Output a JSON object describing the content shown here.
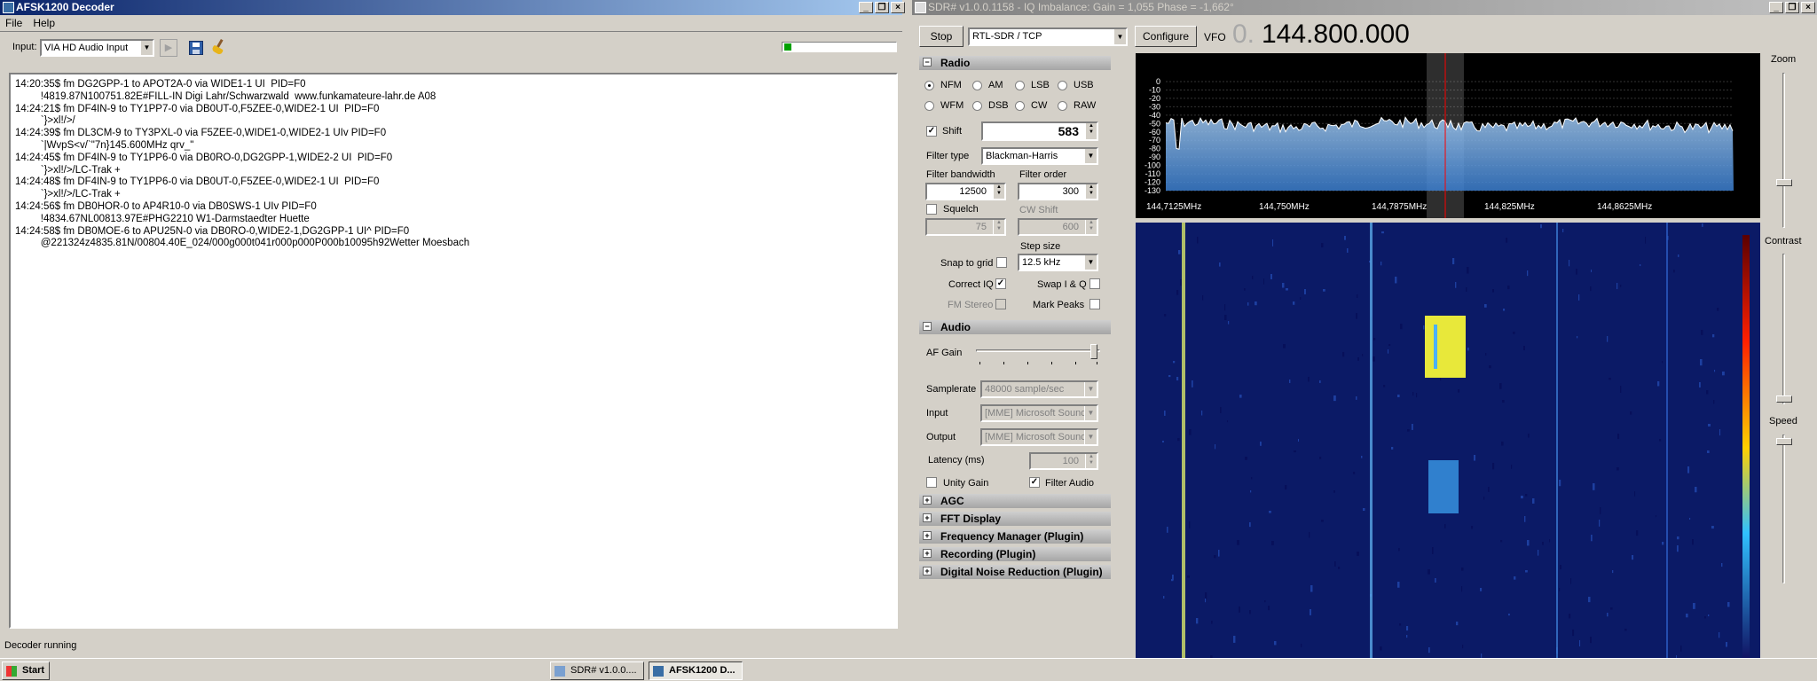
{
  "afsk": {
    "title": "AFSK1200 Decoder",
    "menu": [
      "File",
      "Help"
    ],
    "input_label": "Input:",
    "input_value": "VIA HD Audio Input",
    "log": [
      "14:20:35$ fm DG2GPP-1 to APOT2A-0 via WIDE1-1 UI  PID=F0",
      "         !4819.87N100751.82E#FILL-IN Digi Lahr/Schwarzwald  www.funkamateure-lahr.de A08",
      "14:24:21$ fm DF4IN-9 to TY1PP7-0 via DB0UT-0,F5ZEE-0,WIDE2-1 UI  PID=F0",
      "         `}>xl!/>/",
      "14:24:39$ fm DL3CM-9 to TY3PXL-0 via F5ZEE-0,WIDE1-0,WIDE2-1 UIv PID=F0",
      "         `|WvpS<v/`\"7n}145.600MHz qrv_\"",
      "14:24:45$ fm DF4IN-9 to TY1PP6-0 via DB0RO-0,DG2GPP-1,WIDE2-2 UI  PID=F0",
      "         `}>xl!/>/LC-Trak +",
      "14:24:48$ fm DF4IN-9 to TY1PP6-0 via DB0UT-0,F5ZEE-0,WIDE2-1 UI  PID=F0",
      "         `}>xl!/>/LC-Trak +",
      "14:24:56$ fm DB0HOR-0 to AP4R10-0 via DB0SWS-1 UIv PID=F0",
      "         !4834.67NL00813.97E#PHG2210 W1-Darmstaedter Huette",
      "14:24:58$ fm DB0MOE-6 to APU25N-0 via DB0RO-0,WIDE2-1,DG2GPP-1 UI^ PID=F0",
      "         @221324z4835.81N/00804.40E_024/000g000t041r000p000P000b10095h92Wetter Moesbach"
    ],
    "status": "Decoder running"
  },
  "sdr": {
    "title": "SDR# v1.0.0.1158 - IQ Imbalance: Gain = 1,055 Phase = -1,662°",
    "stop_label": "Stop",
    "source": "RTL-SDR / TCP",
    "configure_label": "Configure",
    "vfo_label": "VFO",
    "vfo_dim": "0.",
    "vfo_value": "144.800.000",
    "radio": {
      "header": "Radio",
      "modes": [
        "NFM",
        "AM",
        "LSB",
        "USB",
        "WFM",
        "DSB",
        "CW",
        "RAW"
      ],
      "selected_mode": "NFM",
      "shift_label": "Shift",
      "shift_value": "583",
      "filter_type_label": "Filter type",
      "filter_type": "Blackman-Harris",
      "filter_bw_label": "Filter bandwidth",
      "filter_bw": "12500",
      "filter_order_label": "Filter order",
      "filter_order": "300",
      "squelch_label": "Squelch",
      "squelch_value": "75",
      "cw_shift_label": "CW Shift",
      "cw_shift_value": "600",
      "step_size_label": "Step size",
      "step_size": "12.5 kHz",
      "snap_label": "Snap to grid",
      "correct_iq_label": "Correct IQ",
      "swap_iq_label": "Swap I & Q",
      "fm_stereo_label": "FM Stereo",
      "mark_peaks_label": "Mark Peaks"
    },
    "audio": {
      "header": "Audio",
      "af_gain_label": "AF Gain",
      "af_gain_level": 0.98,
      "samplerate_label": "Samplerate",
      "samplerate": "48000 sample/sec",
      "input_label": "Input",
      "input": "[MME] Microsoft Sound",
      "output_label": "Output",
      "output": "[MME] Microsoft Sound",
      "latency_label": "Latency (ms)",
      "latency": "100",
      "unity_gain_label": "Unity Gain",
      "filter_audio_label": "Filter Audio"
    },
    "collapsed_sections": [
      "AGC",
      "FFT Display",
      "Frequency Manager (Plugin)",
      "Recording (Plugin)",
      "Digital Noise Reduction (Plugin)"
    ],
    "spectrum": {
      "db_labels": [
        "0",
        "-10",
        "-20",
        "-30",
        "-40",
        "-50",
        "-60",
        "-70",
        "-80",
        "-90",
        "-100",
        "-110",
        "-120",
        "-130"
      ],
      "freq_labels": [
        "144,7125MHz",
        "144,750MHz",
        "144,7875MHz",
        "144,825MHz",
        "144,8625MHz"
      ]
    },
    "zoom_label": "Zoom",
    "contrast_label": "Contrast",
    "speed_label": "Speed",
    "colors": {
      "trace": "#ffffff",
      "marker": "#ff0000",
      "waterfall_bg": "#0b1a66",
      "spectrum_top": "#000000",
      "spectrum_fill": "#3b7fd1"
    }
  },
  "taskbar": {
    "start_label": "Start",
    "tasks": [
      "SDR# v1.0.0....",
      "AFSK1200 D..."
    ]
  }
}
